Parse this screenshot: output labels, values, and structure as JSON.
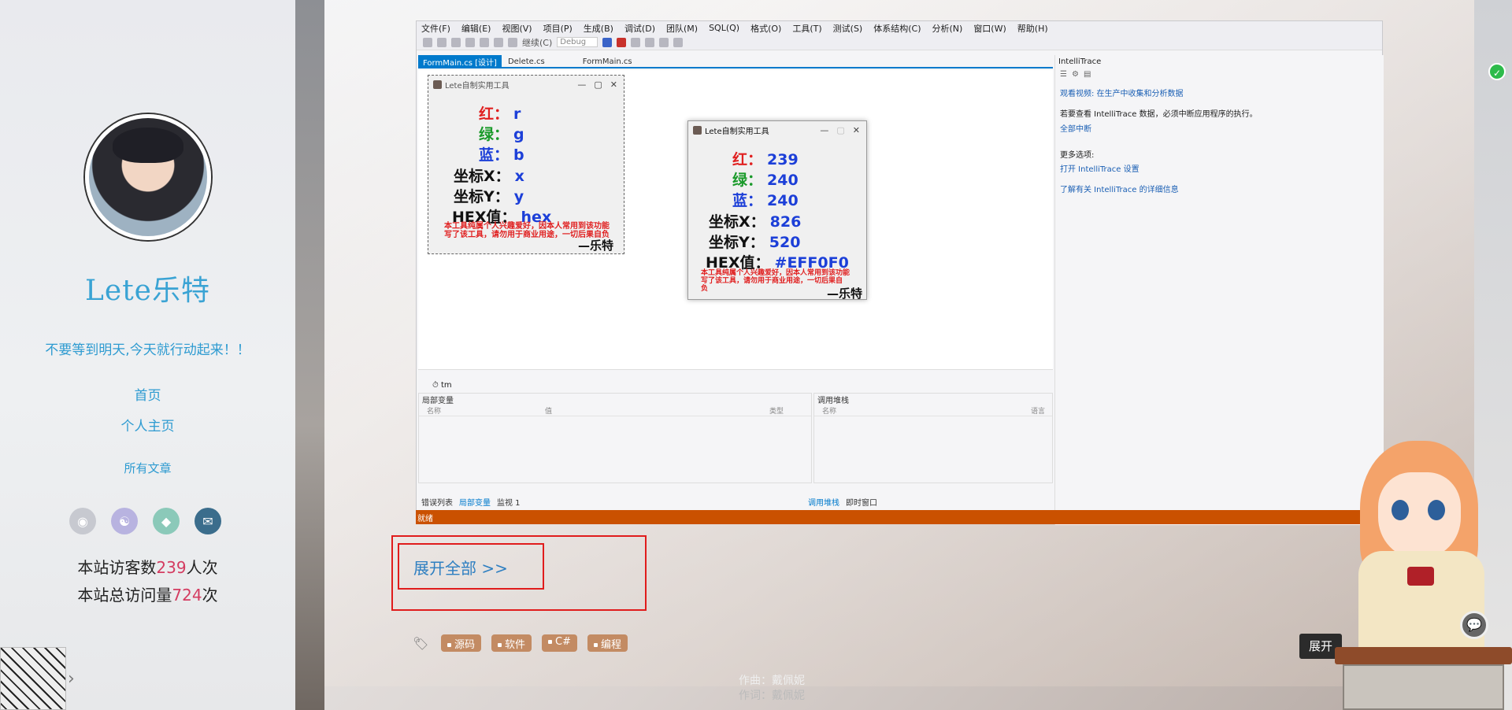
{
  "sidebar": {
    "site_title": "Lete乐特",
    "motto": "不要等到明天,今天就行动起来！！",
    "nav": [
      "首页",
      "个人主页",
      "所有文章"
    ],
    "social_icons": [
      "github-icon",
      "weibo-icon",
      "qq-icon",
      "email-icon"
    ],
    "stats": [
      {
        "prefix": "本站访客数",
        "num": "239",
        "suffix": "人次"
      },
      {
        "prefix": "本站总访问量",
        "num": "724",
        "suffix": "次"
      }
    ]
  },
  "vs": {
    "menu": [
      "文件(F)",
      "编辑(E)",
      "视图(V)",
      "项目(P)",
      "生成(B)",
      "调试(D)",
      "团队(M)",
      "SQL(Q)",
      "格式(O)",
      "工具(T)",
      "测试(S)",
      "体系结构(C)",
      "分析(N)",
      "窗口(W)",
      "帮助(H)"
    ],
    "debug_config": "Debug",
    "continue_label": "继续(C)",
    "tabs": [
      "FormMain.cs [设计]",
      "Delete.cs",
      "FormMain.cs"
    ],
    "tm_label": "tm",
    "status": "就绪",
    "locals_panel": {
      "title": "局部变量",
      "col_name": "名称",
      "col_value": "值",
      "col_type": "类型"
    },
    "callstack_panel": {
      "title": "调用堆栈",
      "col_name": "名称",
      "col_lang": "语言"
    },
    "bottom_tabs_left": [
      "错误列表",
      "局部变量",
      "监视 1"
    ],
    "bottom_tabs_right": [
      "调用堆栈",
      "即时窗口"
    ],
    "intellitrace": {
      "title": "IntelliTrace",
      "video_link": "观看视频: 在生产中收集和分析数据",
      "message": "若要查看 IntelliTrace 数据，必须中断应用程序的执行。",
      "break_all": "全部中断",
      "more_options": "更多选项:",
      "open_settings": "打开 IntelliTrace 设置",
      "learn_more": "了解有关 IntelliTrace 的详细信息"
    }
  },
  "app_design": {
    "title": "Lete自制实用工具",
    "rows": [
      {
        "label": "红：",
        "value": "r"
      },
      {
        "label": "绿：",
        "value": "g"
      },
      {
        "label": "蓝：",
        "value": "b"
      },
      {
        "label": "坐标X：",
        "value": "x"
      },
      {
        "label": "坐标Y：",
        "value": "y"
      },
      {
        "label": "HEX值：",
        "value": "hex"
      }
    ],
    "disclaimer_1": "本工具纯属个人兴趣爱好，因本人常用到该功能",
    "disclaimer_2": "写了该工具，请勿用于商业用途，一切后果自负",
    "signature": "—乐特"
  },
  "app_running": {
    "title": "Lete自制实用工具",
    "rows": [
      {
        "label": "红：",
        "value": "239"
      },
      {
        "label": "绿：",
        "value": "240"
      },
      {
        "label": "蓝：",
        "value": "240"
      },
      {
        "label": "坐标X：",
        "value": "826"
      },
      {
        "label": "坐标Y：",
        "value": "520"
      },
      {
        "label": "HEX值：",
        "value": "#EFF0F0"
      }
    ],
    "disclaimer_1": "本工具纯属个人兴趣爱好，因本人常用到该功能",
    "disclaimer_2": "写了该工具，请勿用于商业用途，一切后果自",
    "disclaimer_3": "负",
    "signature": "—乐特"
  },
  "article": {
    "expand_label": "展开全部  >>",
    "tags": [
      "源码",
      "软件",
      "C#",
      "编程"
    ]
  },
  "lyrics": {
    "composer": "作曲：戴佩妮",
    "lyricist": "作词：戴佩妮"
  },
  "mascot": {
    "expand_mini": "展开"
  }
}
